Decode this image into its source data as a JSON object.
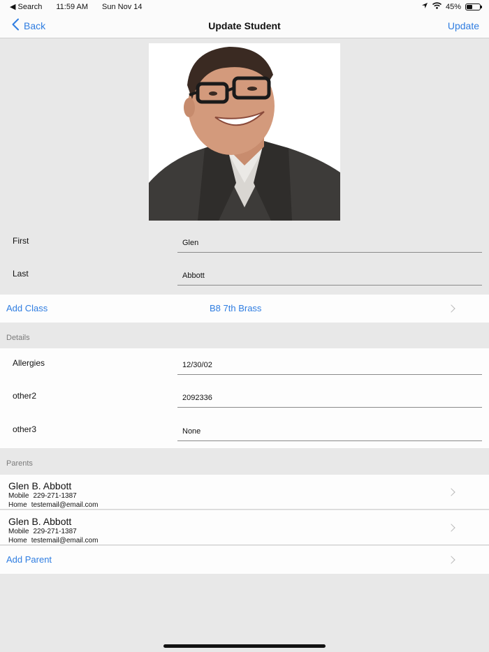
{
  "status_bar": {
    "back_app": "◀ Search",
    "time": "11:59 AM",
    "date": "Sun Nov 14",
    "battery_percent": "45%",
    "battery_level": 0.45
  },
  "nav": {
    "back_label": "Back",
    "title": "Update Student",
    "action_label": "Update"
  },
  "student": {
    "first_label": "First",
    "first_value": "Glen",
    "last_label": "Last",
    "last_value": "Abbott"
  },
  "class_row": {
    "add_label": "Add Class",
    "class_name": "B8 7th Brass"
  },
  "details": {
    "header": "Details",
    "fields": [
      {
        "label": "Allergies",
        "value": "12/30/02"
      },
      {
        "label": "other2",
        "value": "2092336"
      },
      {
        "label": "other3",
        "value": "None"
      }
    ]
  },
  "parents": {
    "header": "Parents",
    "items": [
      {
        "name": "Glen B. Abbott",
        "mobile_label": "Mobile",
        "mobile": "229-271-1387",
        "home_label": "Home",
        "home": "testemail@email.com"
      },
      {
        "name": "Glen B. Abbott",
        "mobile_label": "Mobile",
        "mobile": "229-271-1387",
        "home_label": "Home",
        "home": "testemail@email.com"
      }
    ],
    "add_label": "Add Parent"
  },
  "colors": {
    "accent": "#2f7de1",
    "background": "#e8e8e8",
    "row_background": "#fdfdfd"
  }
}
